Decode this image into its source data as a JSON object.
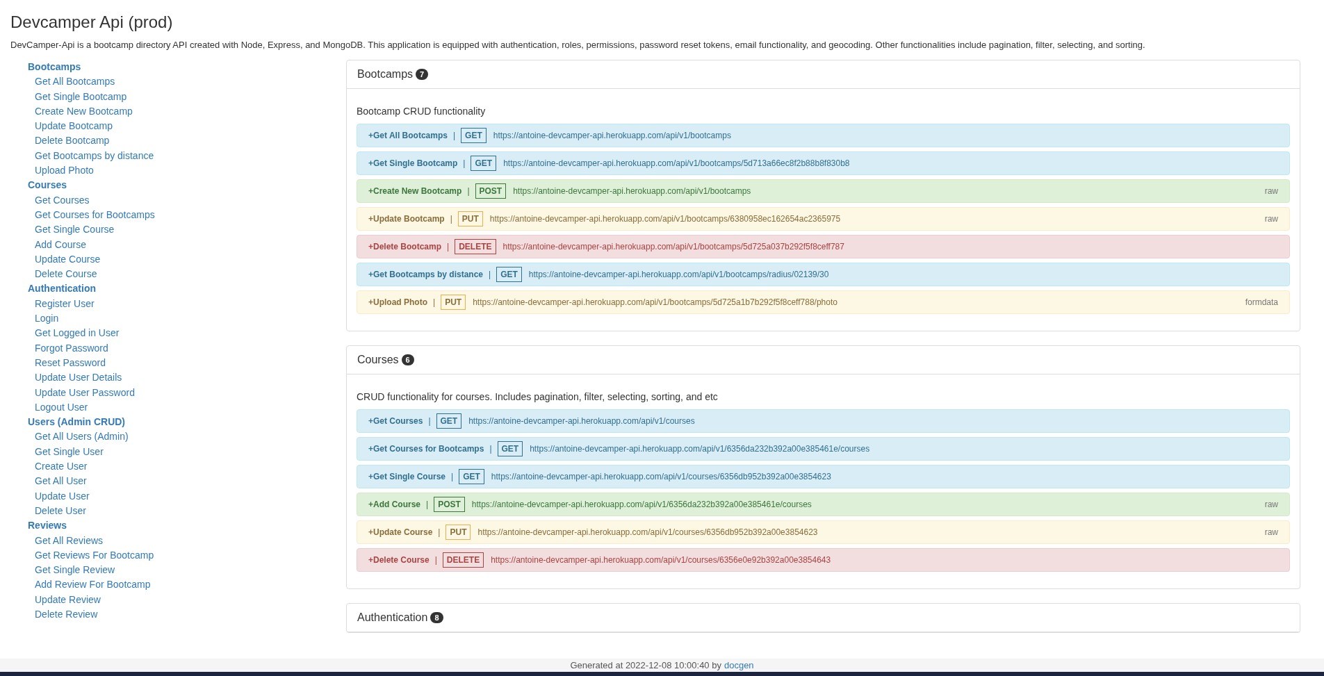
{
  "title": "Devcamper Api (prod)",
  "description": "DevCamper-Api is a bootcamp directory API created with Node, Express, and MongoDB. This application is equipped with authentication, roles, permissions, password reset tokens, email functionality, and geocoding. Other functionalities include pagination, filter, selecting, and sorting.",
  "sidebar": [
    {
      "heading": "Bootcamps",
      "items": [
        "Get All Bootcamps",
        "Get Single Bootcamp",
        "Create New Bootcamp",
        "Update Bootcamp",
        "Delete Bootcamp",
        "Get Bootcamps by distance",
        "Upload Photo"
      ]
    },
    {
      "heading": "Courses",
      "items": [
        "Get Courses",
        "Get Courses for Bootcamps",
        "Get Single Course",
        "Add Course",
        "Update Course",
        "Delete Course"
      ]
    },
    {
      "heading": "Authentication",
      "items": [
        "Register User",
        "Login",
        "Get Logged in User",
        "Forgot Password",
        "Reset Password",
        "Update User Details",
        "Update User Password",
        "Logout User"
      ]
    },
    {
      "heading": "Users (Admin CRUD)",
      "items": [
        "Get All Users (Admin)",
        "Get Single User",
        "Create User",
        "Get All User",
        "Update User",
        "Delete User"
      ]
    },
    {
      "heading": "Reviews",
      "items": [
        "Get All Reviews",
        "Get Reviews For Bootcamp",
        "Get Single Review",
        "Add Review For Bootcamp",
        "Update Review",
        "Delete Review"
      ]
    }
  ],
  "panels": [
    {
      "title": "Bootcamps",
      "count": "7",
      "description": "Bootcamp CRUD functionality",
      "endpoints": [
        {
          "kind": "get",
          "name": "+Get All Bootcamps",
          "separator": "|",
          "method": "GET",
          "url": "https://antoine-devcamper-api.herokuapp.com/api/v1/bootcamps"
        },
        {
          "kind": "get",
          "name": "+Get Single Bootcamp",
          "separator": "|",
          "method": "GET",
          "url": "https://antoine-devcamper-api.herokuapp.com/api/v1/bootcamps/5d713a66ec8f2b88b8f830b8"
        },
        {
          "kind": "post",
          "name": "+Create New Bootcamp",
          "separator": "|",
          "method": "POST",
          "url": "https://antoine-devcamper-api.herokuapp.com/api/v1/bootcamps",
          "body_type": "raw"
        },
        {
          "kind": "put",
          "name": "+Update Bootcamp",
          "separator": "|",
          "method": "PUT",
          "url": "https://antoine-devcamper-api.herokuapp.com/api/v1/bootcamps/6380958ec162654ac2365975",
          "body_type": "raw"
        },
        {
          "kind": "delete",
          "name": "+Delete Bootcamp",
          "separator": "|",
          "method": "DELETE",
          "url": "https://antoine-devcamper-api.herokuapp.com/api/v1/bootcamps/5d725a037b292f5f8ceff787"
        },
        {
          "kind": "get",
          "name": "+Get Bootcamps by distance",
          "separator": "|",
          "method": "GET",
          "url": "https://antoine-devcamper-api.herokuapp.com/api/v1/bootcamps/radius/02139/30"
        },
        {
          "kind": "put",
          "name": "+Upload Photo",
          "separator": "|",
          "method": "PUT",
          "url": "https://antoine-devcamper-api.herokuapp.com/api/v1/bootcamps/5d725a1b7b292f5f8ceff788/photo",
          "body_type": "formdata"
        }
      ]
    },
    {
      "title": "Courses",
      "count": "6",
      "description": "CRUD functionality for courses. Includes pagination, filter, selecting, sorting, and etc",
      "endpoints": [
        {
          "kind": "get",
          "name": "+Get Courses",
          "separator": "|",
          "method": "GET",
          "url": "https://antoine-devcamper-api.herokuapp.com/api/v1/courses"
        },
        {
          "kind": "get",
          "name": "+Get Courses for Bootcamps",
          "separator": "|",
          "method": "GET",
          "url": "https://antoine-devcamper-api.herokuapp.com/api/v1/6356da232b392a00e385461e/courses"
        },
        {
          "kind": "get",
          "name": "+Get Single Course",
          "separator": "|",
          "method": "GET",
          "url": "https://antoine-devcamper-api.herokuapp.com/api/v1/courses/6356db952b392a00e3854623"
        },
        {
          "kind": "post",
          "name": "+Add Course",
          "separator": "|",
          "method": "POST",
          "url": "https://antoine-devcamper-api.herokuapp.com/api/v1/6356da232b392a00e385461e/courses",
          "body_type": "raw"
        },
        {
          "kind": "put",
          "name": "+Update Course",
          "separator": "|",
          "method": "PUT",
          "url": "https://antoine-devcamper-api.herokuapp.com/api/v1/courses/6356db952b392a00e3854623",
          "body_type": "raw"
        },
        {
          "kind": "delete",
          "name": "+Delete Course",
          "separator": "|",
          "method": "DELETE",
          "url": "https://antoine-devcamper-api.herokuapp.com/api/v1/courses/6356e0e92b392a00e3854643"
        }
      ]
    },
    {
      "title": "Authentication",
      "count": "8"
    }
  ],
  "footer": {
    "text": "Generated at 2022-12-08 10:00:40 by",
    "link": "docgen"
  }
}
